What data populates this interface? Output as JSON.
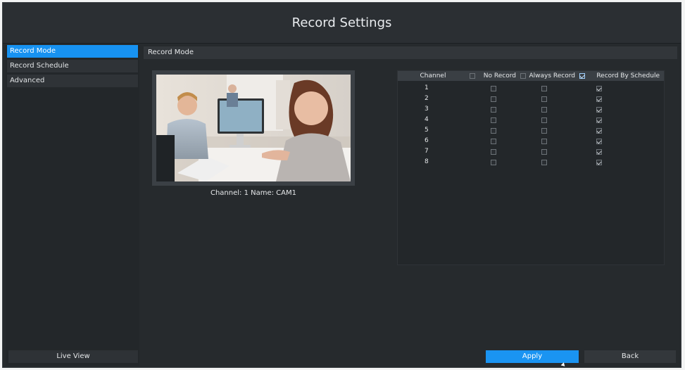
{
  "window": {
    "title": "Record Settings"
  },
  "sidebar": {
    "items": [
      {
        "label": "Record Mode",
        "active": true
      },
      {
        "label": "Record Schedule",
        "active": false
      },
      {
        "label": "Advanced",
        "active": false
      }
    ],
    "live_view_label": "Live View"
  },
  "main": {
    "section_title": "Record Mode",
    "preview_caption": "Channel: 1 Name: CAM1",
    "table": {
      "headers": {
        "channel": "Channel",
        "no_record": "No Record",
        "always_record": "Always Record",
        "record_by_schedule": "Record By Schedule"
      },
      "header_checked": {
        "no_record": false,
        "always_record": false,
        "record_by_schedule": true
      },
      "rows": [
        {
          "channel": "1",
          "no_record": false,
          "always_record": false,
          "record_by_schedule": true
        },
        {
          "channel": "2",
          "no_record": false,
          "always_record": false,
          "record_by_schedule": true
        },
        {
          "channel": "3",
          "no_record": false,
          "always_record": false,
          "record_by_schedule": true
        },
        {
          "channel": "4",
          "no_record": false,
          "always_record": false,
          "record_by_schedule": true
        },
        {
          "channel": "5",
          "no_record": false,
          "always_record": false,
          "record_by_schedule": true
        },
        {
          "channel": "6",
          "no_record": false,
          "always_record": false,
          "record_by_schedule": true
        },
        {
          "channel": "7",
          "no_record": false,
          "always_record": false,
          "record_by_schedule": true
        },
        {
          "channel": "8",
          "no_record": false,
          "always_record": false,
          "record_by_schedule": true
        }
      ]
    }
  },
  "buttons": {
    "apply": "Apply",
    "back": "Back"
  },
  "colors": {
    "accent": "#1792f1",
    "background": "#262a2d",
    "panel": "#23272a"
  }
}
